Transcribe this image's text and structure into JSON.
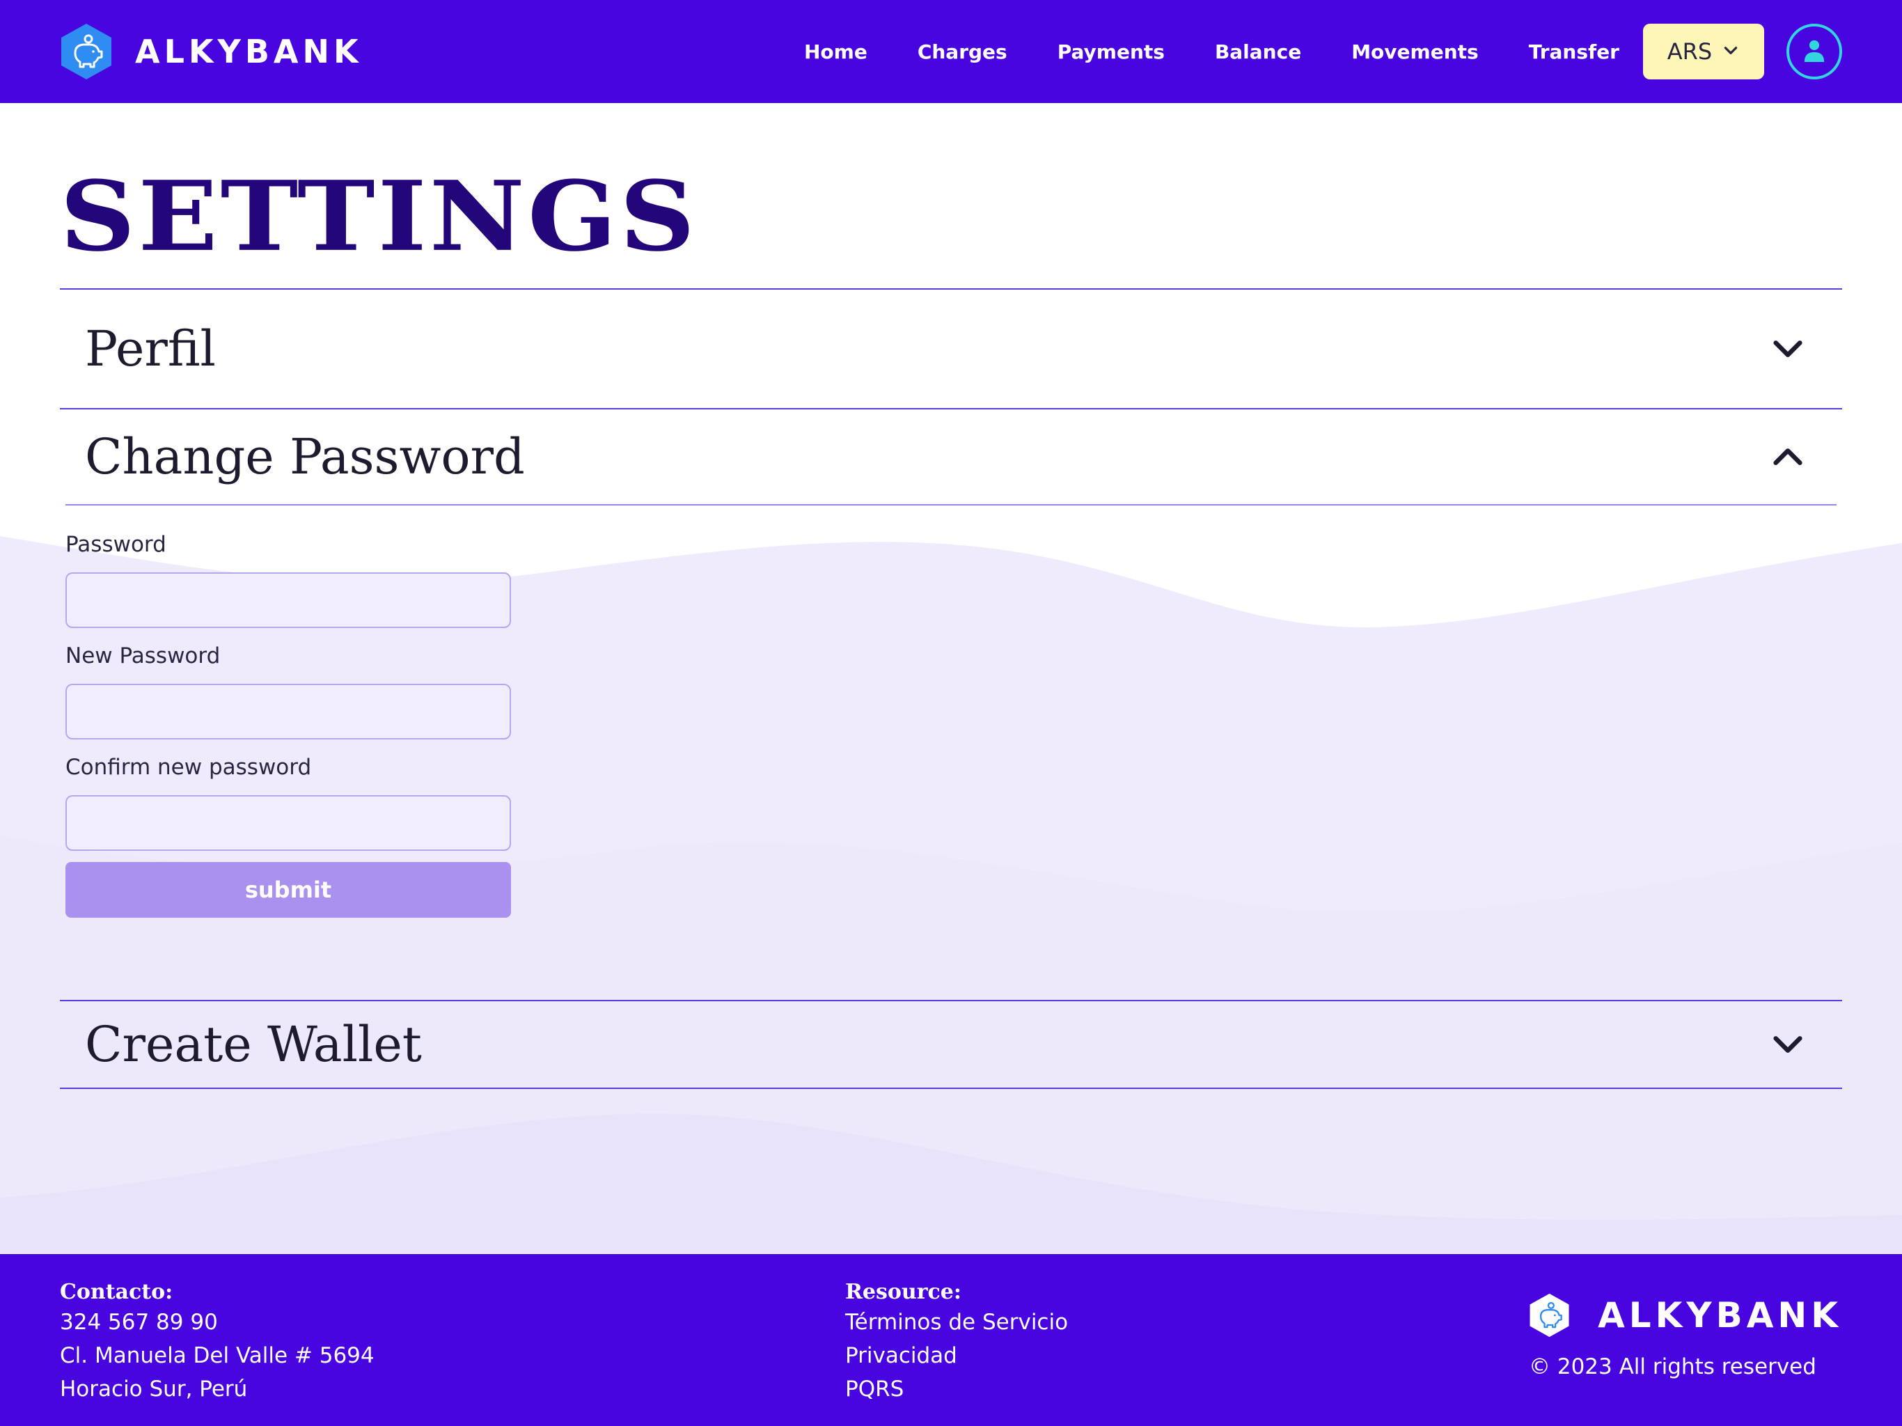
{
  "brand": {
    "name": "ALKYBANK",
    "logo_icon": "piggy-bank-hexagon-icon"
  },
  "nav": {
    "links": [
      {
        "label": "Home"
      },
      {
        "label": "Charges"
      },
      {
        "label": "Payments"
      },
      {
        "label": "Balance"
      },
      {
        "label": "Movements"
      },
      {
        "label": "Transfer"
      }
    ],
    "currency": {
      "selected": "ARS",
      "icon": "chevron-down-icon"
    },
    "user_icon": "user-icon"
  },
  "page": {
    "title": "SETTINGS"
  },
  "accordion": {
    "sections": [
      {
        "title": "Perfil",
        "expanded": false,
        "icon": "chevron-down-icon"
      },
      {
        "title": "Change Password",
        "expanded": true,
        "icon": "chevron-up-icon",
        "form": {
          "password_label": "Password",
          "password_value": "",
          "new_password_label": "New Password",
          "new_password_value": "",
          "confirm_label": "Confirm new password",
          "confirm_value": "",
          "submit_label": "submit"
        }
      },
      {
        "title": "Create Wallet",
        "expanded": false,
        "icon": "chevron-down-icon"
      }
    ]
  },
  "footer": {
    "contact": {
      "heading": "Contacto:",
      "phone": "324 567 89 90",
      "address_line1": "Cl. Manuela Del Valle # 5694",
      "address_line2": "Horacio Sur, Perú"
    },
    "resource": {
      "heading": "Resource:",
      "links": [
        "Términos de Servicio",
        "Privacidad",
        "PQRS"
      ]
    },
    "brand_name": "ALKYBANK",
    "copyright": "© 2023 All rights reserved"
  },
  "colors": {
    "primary": "#4905e0",
    "title": "#23077a",
    "currency_bg": "#fef6b7",
    "avatar_ring": "#33d6e0",
    "submit_bg": "#ab91ef",
    "wave": "#efebfc"
  }
}
